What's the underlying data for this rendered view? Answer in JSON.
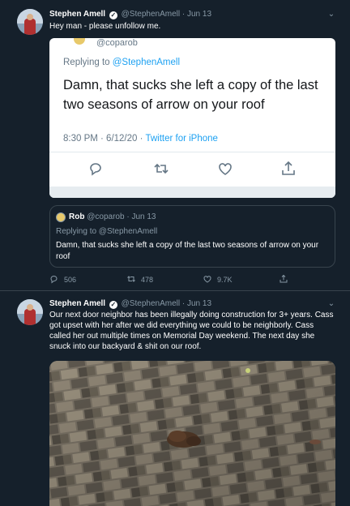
{
  "tweet1": {
    "name": "Stephen Amell",
    "handle": "@StephenAmell",
    "dot": "·",
    "date": "Jun 13",
    "text": "Hey man - please unfollow me.",
    "screenshot": {
      "handle": "@coparob",
      "replying_to_prefix": "Replying to ",
      "replying_to": "@StephenAmell",
      "text": "Damn, that sucks she left a copy of the last two seasons of arrow on your roof",
      "time": "8:30 PM · 6/12/20 · ",
      "source": "Twitter for iPhone"
    },
    "quote": {
      "name": "Rob",
      "handle": "@coparob",
      "dot": "·",
      "date": "Jun 13",
      "replying_to": "Replying to @StephenAmell",
      "text": "Damn, that sucks she left a copy of the last two seasons of arrow on your roof"
    },
    "actions": {
      "replies": "506",
      "retweets": "478",
      "likes": "9.7K"
    }
  },
  "tweet2": {
    "name": "Stephen Amell",
    "handle": "@StephenAmell",
    "dot": "·",
    "date": "Jun 13",
    "text": "Our next door neighbor has been illegally doing construction for 3+ years. Cass got upset with her after we did everything we could to be neighborly. Cass called her out multiple times on Memorial Day weekend. The next day she snuck into our backyard & shit on our roof."
  },
  "icons": {
    "verified": "check-icon",
    "chevron": "chevron-down-icon",
    "reply": "reply-icon",
    "retweet": "retweet-icon",
    "like": "heart-icon",
    "share": "share-icon"
  },
  "colors": {
    "background": "#15202b",
    "muted": "#8899a6",
    "link": "#1da1f2",
    "border": "#38444d"
  }
}
